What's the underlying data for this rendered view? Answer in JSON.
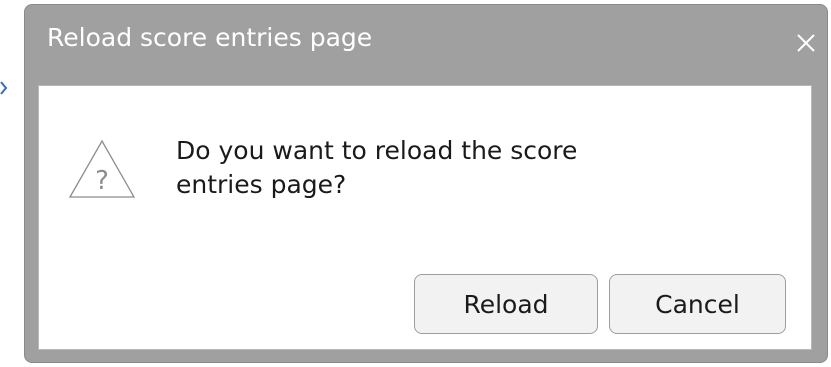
{
  "dialog": {
    "title": "Reload score entries page",
    "close_glyph": "X",
    "close_icon": "close-icon",
    "icon": "warning-question-icon",
    "icon_glyph": "?",
    "message": "Do you want to reload the score entries page?",
    "buttons": {
      "reload_label": "Reload",
      "cancel_label": "Cancel"
    }
  },
  "colors": {
    "titlebar": "#a0a0a0",
    "title_text": "#ffffff",
    "content_background": "#ffffff",
    "button_background": "#f2f2f2",
    "edge_arrow": "#3b6fb5"
  }
}
